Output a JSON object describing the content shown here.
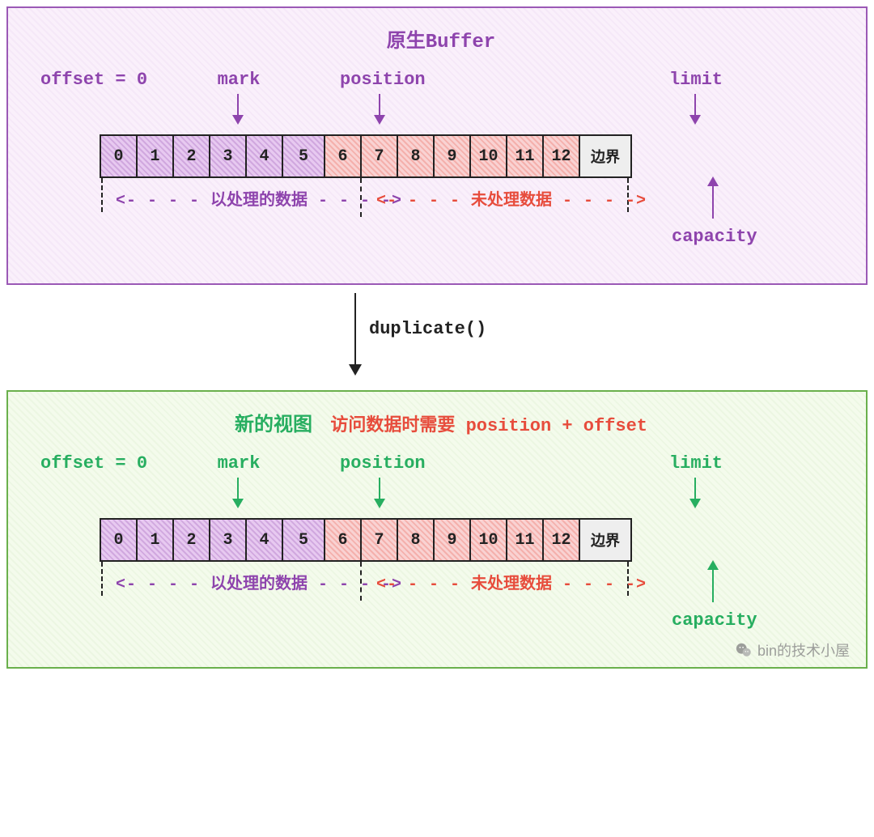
{
  "top": {
    "title": "原生Buffer",
    "offset": "offset = 0",
    "mark": "mark",
    "position": "position",
    "limit": "limit",
    "capacity": "capacity",
    "range_processed": "以处理的数据",
    "range_unprocessed": "未处理数据"
  },
  "bottom": {
    "title_main": "新的视图",
    "title_sub": "访问数据时需要 position + offset",
    "offset": "offset = 0",
    "mark": "mark",
    "position": "position",
    "limit": "limit",
    "capacity": "capacity",
    "range_processed": "以处理的数据",
    "range_unprocessed": "未处理数据"
  },
  "cells": {
    "purple": [
      "0",
      "1",
      "2",
      "3",
      "4",
      "5"
    ],
    "red": [
      "6",
      "7",
      "8",
      "9",
      "10",
      "11",
      "12"
    ],
    "boundary": "边界"
  },
  "connector": "duplicate()",
  "watermark": "bin的技术小屋",
  "colors": {
    "purple": "#8e44ad",
    "green": "#27ae60",
    "red": "#e74c3c"
  },
  "chart_data": {
    "type": "table",
    "description": "Buffer duplicate() operation diagram showing original buffer (top) and new view (bottom) sharing same data with independent position/limit/mark pointers.",
    "buffer_indices": [
      0,
      1,
      2,
      3,
      4,
      5,
      6,
      7,
      8,
      9,
      10,
      11,
      12
    ],
    "mark_index": 3,
    "position_index": 6,
    "limit_index": 13,
    "capacity_index": 13,
    "offset": 0,
    "processed_range": "0-5",
    "unprocessed_range": "6-12",
    "operation": "duplicate()",
    "note": "New view accesses data via position + offset"
  }
}
